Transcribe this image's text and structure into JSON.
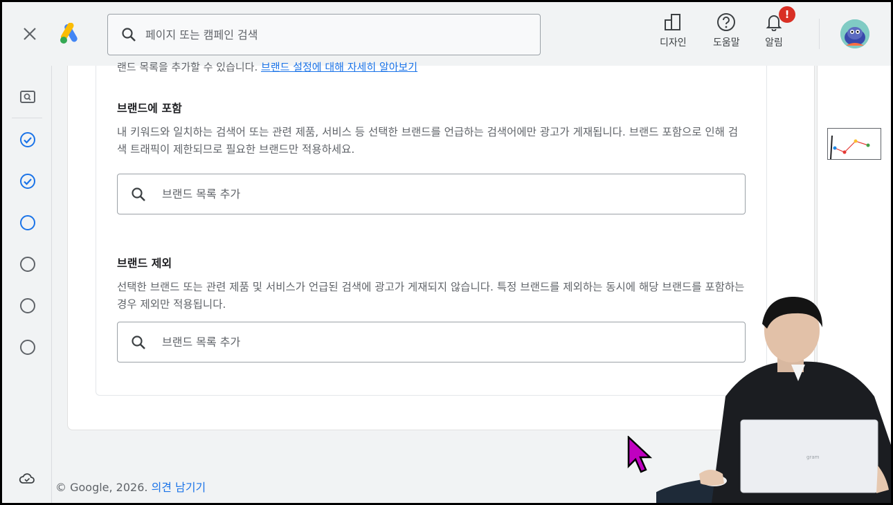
{
  "header": {
    "close_icon": "close-icon",
    "logo": "google-ads-logo",
    "search_placeholder": "페이지 또는 캠페인 검색",
    "actions": [
      {
        "label": "디자인",
        "icon": "design-icon"
      },
      {
        "label": "도움말",
        "icon": "help-icon"
      },
      {
        "label": "알림",
        "icon": "bell-icon",
        "badge": "!"
      }
    ],
    "avatar_icon": "avatar"
  },
  "rail": {
    "items": [
      {
        "icon": "preview-icon",
        "state": "search"
      },
      {
        "icon": "check-circle-icon",
        "state": "done"
      },
      {
        "icon": "check-circle-icon",
        "state": "done"
      },
      {
        "icon": "circle-icon",
        "state": "current"
      },
      {
        "icon": "circle-icon",
        "state": "todo"
      },
      {
        "icon": "circle-icon",
        "state": "todo"
      },
      {
        "icon": "circle-icon",
        "state": "todo"
      }
    ],
    "bottom_icon": "cloud-sync-icon"
  },
  "content": {
    "clipped_text": "랜드 목록을 추가할 수 있습니다.",
    "clipped_link": "브랜드 설정에 대해 자세히 알아보기",
    "include_section": {
      "title": "브랜드에 포함",
      "description": "내 키워드와 일치하는 검색어 또는 관련 제품, 서비스 등 선택한 브랜드를 언급하는 검색어에만 광고가 게재됩니다. 브랜드 포함으로 인해 검색 트래픽이 제한되므로 필요한 브랜드만 적용하세요.",
      "input_placeholder": "브랜드 목록 추가"
    },
    "exclude_section": {
      "title": "브랜드 제외",
      "description": "선택한 브랜드 또는 관련 제품 및 서비스가 언급된 검색에 광고가 게재되지 않습니다. 특정 브랜드를 제외하는 동시에 해당 브랜드를 포함하는 경우 제외만 적용됩니다.",
      "input_placeholder": "브랜드 목록 추가"
    }
  },
  "footer": {
    "copyright": "© Google, 2026.",
    "feedback_link": "의견 남기기"
  },
  "colors": {
    "accent": "#1a73e8",
    "alert": "#d93025",
    "background": "#f1f3f4"
  },
  "overlay": {
    "laptop_text": "gram"
  }
}
